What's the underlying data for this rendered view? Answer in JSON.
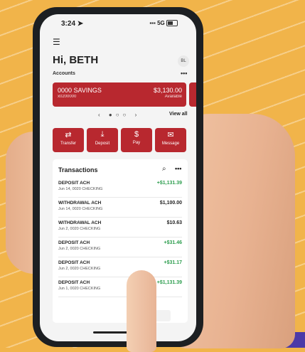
{
  "status_bar": {
    "time": "3:24 ➤",
    "signal": "5G"
  },
  "header": {
    "greeting": "Hi, BETH",
    "avatar_initials": "BL"
  },
  "accounts": {
    "label": "Accounts",
    "more": "•••",
    "card": {
      "name": "0000 SAVINGS",
      "number": "x0200000",
      "balance": "$3,130.00",
      "balance_label": "Available"
    },
    "pager": "‹ ●○○ ›",
    "view_all": "View all"
  },
  "actions": [
    {
      "label": "Transfer",
      "icon": "⇄"
    },
    {
      "label": "Deposit",
      "icon": "⤓"
    },
    {
      "label": "Pay",
      "icon": "$"
    },
    {
      "label": "Message",
      "icon": "✉"
    }
  ],
  "transactions": {
    "title": "Transactions",
    "more": "•••",
    "rows": [
      {
        "desc": "DEPOSIT ACH",
        "sub": "Jun 14, 0020 CHECKING",
        "amount": "+$1,131.39",
        "type": "credit"
      },
      {
        "desc": "WITHDRAWAL ACH",
        "sub": "Jun 14, 0020 CHECKING",
        "amount": "$1,100.00",
        "type": "debit"
      },
      {
        "desc": "WITHDRAWAL ACH",
        "sub": "Jun 2, 0020 CHECKING",
        "amount": "$10.63",
        "type": "debit"
      },
      {
        "desc": "DEPOSIT ACH",
        "sub": "Jun 2, 0020 CHECKING",
        "amount": "+$31.46",
        "type": "credit"
      },
      {
        "desc": "DEPOSIT ACH",
        "sub": "Jun 2, 0020 CHECKING",
        "amount": "+$31.17",
        "type": "credit"
      },
      {
        "desc": "DEPOSIT ACH",
        "sub": "Jun 1, 0020 CHECKING",
        "amount": "+$1,131.39",
        "type": "credit"
      }
    ],
    "see_more": "ore"
  },
  "colors": {
    "brand_red": "#b8282f",
    "credit_green": "#2e9e4f",
    "debit_dark": "#222222",
    "background": "#f1b44a"
  }
}
